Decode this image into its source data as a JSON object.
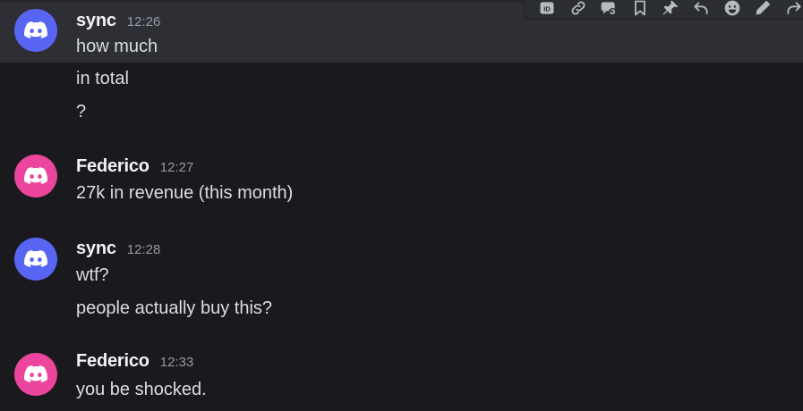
{
  "toolbar": {
    "icons": [
      "id-icon",
      "link-icon",
      "thread-icon",
      "bookmark-icon",
      "pin-icon",
      "reply-icon",
      "emoji-icon",
      "edit-icon",
      "forward-icon"
    ]
  },
  "colors": {
    "background": "#1a1a1e",
    "hover": "#2e2f35",
    "blurple": "#5865f2",
    "pink": "#eb459e"
  },
  "messages": [
    {
      "author": "sync",
      "time": "12:26",
      "avatar_color": "#5865f2",
      "lines": [
        "how much",
        "in total",
        "?"
      ]
    },
    {
      "author": "Federico",
      "time": "12:27",
      "avatar_color": "#eb459e",
      "lines": [
        "27k in revenue (this month)"
      ]
    },
    {
      "author": "sync",
      "time": "12:28",
      "avatar_color": "#5865f2",
      "lines": [
        "wtf?",
        "people actually buy this?"
      ]
    },
    {
      "author": "Federico",
      "time": "12:33",
      "avatar_color": "#eb459e",
      "lines": [
        "you be shocked."
      ]
    }
  ]
}
